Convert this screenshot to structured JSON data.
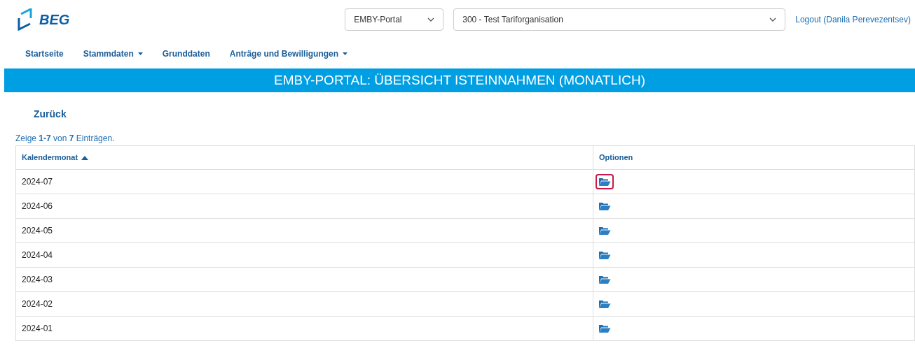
{
  "logo": {
    "text": "BEG"
  },
  "selects": [
    {
      "value": "EMBY-Portal"
    },
    {
      "value": "300 - Test Tariforganisation"
    }
  ],
  "logout": "Logout (Danila Perevezentsev)",
  "nav": [
    {
      "label": "Startseite",
      "dropdown": false
    },
    {
      "label": "Stammdaten",
      "dropdown": true
    },
    {
      "label": "Grunddaten",
      "dropdown": false
    },
    {
      "label": "Anträge und Bewilligungen",
      "dropdown": true
    }
  ],
  "banner": "EMBY-PORTAL: ÜBERSICHT ISTEINNAHMEN (MONATLICH)",
  "back": "Zurück",
  "summary": "Zeige **1-7** von **7** Einträgen.",
  "table": {
    "columns": [
      {
        "label": "Kalendermonat",
        "sorted": true
      },
      {
        "label": "Optionen",
        "sorted": false
      }
    ],
    "rows": [
      {
        "month": "2024-07",
        "focused": true
      },
      {
        "month": "2024-06",
        "focused": false
      },
      {
        "month": "2024-05",
        "focused": false
      },
      {
        "month": "2024-04",
        "focused": false
      },
      {
        "month": "2024-03",
        "focused": false
      },
      {
        "month": "2024-02",
        "focused": false
      },
      {
        "month": "2024-01",
        "focused": false
      }
    ]
  }
}
